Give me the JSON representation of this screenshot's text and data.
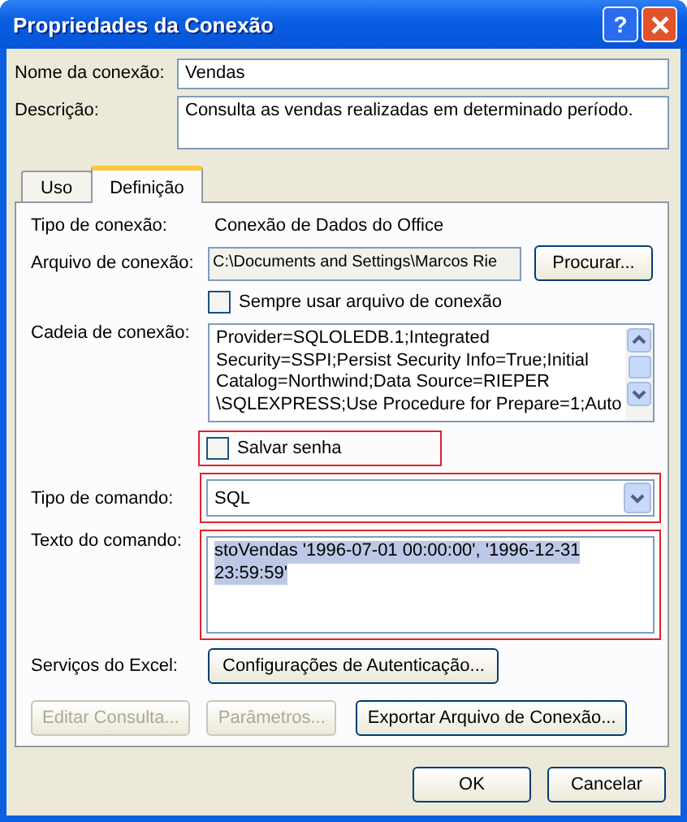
{
  "window": {
    "title": "Propriedades da Conexão",
    "help_button": "?"
  },
  "name": {
    "label": "Nome da conexão:",
    "value": "Vendas"
  },
  "description": {
    "label": "Descrição:",
    "value": "Consulta as vendas realizadas em determinado período."
  },
  "tabs": [
    {
      "label": "Uso",
      "selected": false
    },
    {
      "label": "Definição",
      "selected": true
    }
  ],
  "connection_type": {
    "label": "Tipo de conexão:",
    "value": "Conexão de Dados do Office"
  },
  "connection_file": {
    "label": "Arquivo de conexão:",
    "value": "C:\\Documents and Settings\\Marcos Rie",
    "button": "Procurar..."
  },
  "always_use_file": {
    "label": "Sempre usar arquivo de conexão",
    "checked": false
  },
  "connection_string": {
    "label": "Cadeia de conexão:",
    "lines": [
      "Provider=SQLOLEDB.1;Integrated",
      "Security=SSPI;Persist Security Info=True;Initial",
      "Catalog=Northwind;Data Source=RIEPER",
      "\\SQLEXPRESS;Use Procedure for Prepare=1;Auto"
    ]
  },
  "save_password": {
    "label": "Salvar senha",
    "checked": false,
    "highlighted": true
  },
  "command_type": {
    "label": "Tipo de comando:",
    "value": "SQL",
    "highlighted": true
  },
  "command_text": {
    "label": "Texto do comando:",
    "lines": [
      "stoVendas '1996-07-01 00:00:00', '1996-12-31",
      "23:59:59'"
    ],
    "text_selected": true,
    "highlighted": true
  },
  "excel_services": {
    "label": "Serviços do Excel:",
    "button": "Configurações de Autenticação..."
  },
  "panel_buttons": [
    {
      "label": "Editar Consulta...",
      "disabled": true
    },
    {
      "label": "Parâmetros...",
      "disabled": true
    },
    {
      "label": "Exportar Arquivo de Conexão...",
      "disabled": false
    }
  ],
  "buttons": [
    "OK",
    "Cancelar"
  ]
}
